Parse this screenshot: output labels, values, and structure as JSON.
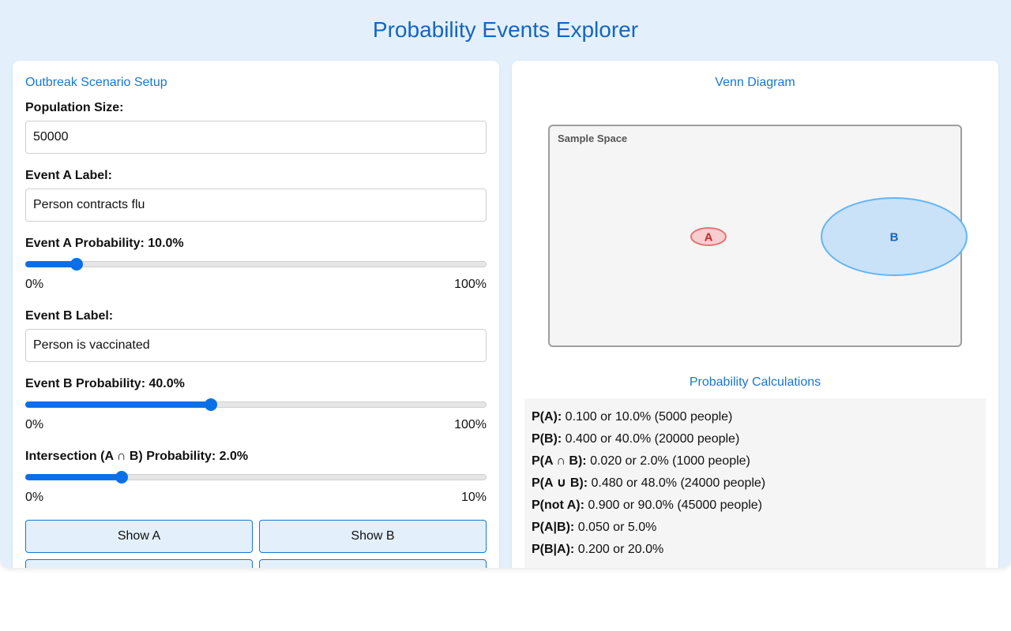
{
  "app": {
    "title": "Probability Events Explorer"
  },
  "setup": {
    "title": "Outbreak Scenario Setup",
    "population_label": "Population Size:",
    "population_value": "50000",
    "event_a_label_title": "Event A Label:",
    "event_a_label_value": "Person contracts flu",
    "event_a_prob_title": "Event A Probability: 10.0%",
    "event_a_prob": 0.1,
    "event_a_min": "0%",
    "event_a_max": "100%",
    "event_b_label_title": "Event B Label:",
    "event_b_label_value": "Person is vaccinated",
    "event_b_prob_title": "Event B Probability: 40.0%",
    "event_b_prob": 0.4,
    "event_b_min": "0%",
    "event_b_max": "100%",
    "intersection_title": "Intersection (A ∩ B) Probability: 2.0%",
    "intersection_prob": 0.02,
    "intersection_min": "0%",
    "intersection_max": "10%",
    "buttons": {
      "show_a": "Show A",
      "show_b": "Show B",
      "third": "",
      "fourth": ""
    }
  },
  "venn": {
    "title": "Venn Diagram",
    "sample_space_label": "Sample Space",
    "circle_a_label": "A",
    "circle_b_label": "B",
    "colors": {
      "a_fill": "#f8cdd0",
      "a_stroke": "#e57373",
      "a_text": "#c62828",
      "b_fill": "#c9e2f7",
      "b_stroke": "#64b5f6",
      "b_text": "#1565c0"
    }
  },
  "calculations": {
    "title": "Probability Calculations",
    "rows": [
      {
        "label": "P(A):",
        "value": " 0.100 or 10.0% (5000 people)"
      },
      {
        "label": "P(B):",
        "value": " 0.400 or 40.0% (20000 people)"
      },
      {
        "label": "P(A ∩ B):",
        "value": " 0.020 or 2.0% (1000 people)"
      },
      {
        "label": "P(A ∪ B):",
        "value": " 0.480 or 48.0% (24000 people)"
      },
      {
        "label": "P(not A):",
        "value": " 0.900 or 90.0% (45000 people)"
      },
      {
        "label": "P(A|B):",
        "value": " 0.050 or 5.0%"
      },
      {
        "label": "P(B|A):",
        "value": " 0.200 or 20.0%"
      }
    ]
  },
  "theme": {
    "accent": "#1976d2",
    "title_color": "#1565c0",
    "slider": "#0b6fe8",
    "background": "#e3f0fb"
  }
}
